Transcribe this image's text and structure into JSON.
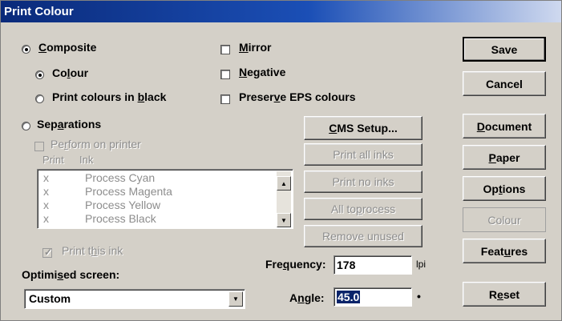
{
  "window": {
    "title": "Print Colour"
  },
  "options": {
    "composite": {
      "label_pre": "",
      "accel": "C",
      "label_post": "omposite",
      "selected": true
    },
    "colour": {
      "label_pre": "Co",
      "accel": "l",
      "label_post": "our",
      "selected": true
    },
    "print_black": {
      "label_pre": "Print colours in ",
      "accel": "b",
      "label_post": "lack",
      "selected": false
    },
    "separations": {
      "label_pre": "Sep",
      "accel": "a",
      "label_post": "rations",
      "selected": false
    },
    "mirror": {
      "label_pre": "",
      "accel": "M",
      "label_post": "irror",
      "checked": false
    },
    "negative": {
      "label_pre": "",
      "accel": "N",
      "label_post": "egative",
      "checked": false
    },
    "preserve_eps": {
      "label_pre": "Preser",
      "accel": "v",
      "label_post": "e EPS colours",
      "checked": false
    },
    "perform_on_printer": {
      "label_pre": "Pe",
      "accel": "r",
      "label_post": "form on printer",
      "checked": false
    },
    "print_this_ink": {
      "label_pre": "Print t",
      "accel": "h",
      "label_post": "is ink",
      "checked": true
    }
  },
  "ink_list": {
    "col_print": "Print",
    "col_ink": "Ink",
    "rows": [
      {
        "print": "x",
        "ink": "Process Cyan"
      },
      {
        "print": "x",
        "ink": "Process Magenta"
      },
      {
        "print": "x",
        "ink": "Process Yellow"
      },
      {
        "print": "x",
        "ink": "Process Black"
      }
    ]
  },
  "mid_buttons": {
    "cms_setup": {
      "label_pre": "",
      "accel": "C",
      "label_post": "MS Setup..."
    },
    "print_all_inks": "Print all inks",
    "print_no_inks": "Print no inks",
    "all_to_process": {
      "label_pre": "All to ",
      "accel": "p",
      "label_post": "rocess"
    },
    "remove_unused": "Remove unused"
  },
  "right_buttons": {
    "save": "Save",
    "cancel": "Cancel",
    "document": {
      "label_pre": "",
      "accel": "D",
      "label_post": "ocument"
    },
    "paper": {
      "label_pre": "",
      "accel": "P",
      "label_post": "aper"
    },
    "options": {
      "label_pre": "Op",
      "accel": "t",
      "label_post": "ions"
    },
    "colour": "Colour",
    "features": {
      "label_pre": "Feat",
      "accel": "u",
      "label_post": "res"
    },
    "reset": {
      "label_pre": "R",
      "accel": "e",
      "label_post": "set"
    }
  },
  "screen": {
    "label_pre": "Optimi",
    "accel": "s",
    "label_post": "ed screen:",
    "value": "Custom"
  },
  "frequency": {
    "label_pre": "Fre",
    "accel": "q",
    "label_post": "uency:",
    "value": "178",
    "unit": "lpi"
  },
  "angle": {
    "label_pre": "A",
    "accel": "n",
    "label_post": "gle:",
    "value": "45.0",
    "unit": "•"
  }
}
